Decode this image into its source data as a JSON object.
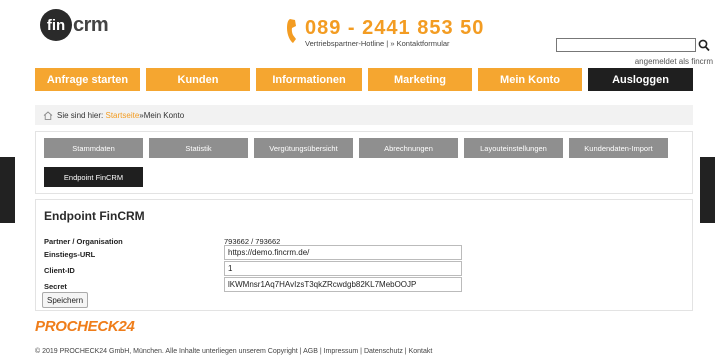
{
  "header": {
    "logo_circle": "fin",
    "logo_text": "crm",
    "phone": "089 - 2441 853 50",
    "hotline": "Vertriebspartner-Hotline",
    "hotline_sep": " | » ",
    "contact_link": "Kontaktformular",
    "search_placeholder": "",
    "logged_in": "angemeldet als fincrm"
  },
  "nav": {
    "items": [
      {
        "label": "Anfrage starten"
      },
      {
        "label": "Kunden"
      },
      {
        "label": "Informationen"
      },
      {
        "label": "Marketing"
      },
      {
        "label": "Mein Konto"
      },
      {
        "label": "Ausloggen"
      }
    ]
  },
  "breadcrumb": {
    "prefix": "Sie sind hier:",
    "home": "Startseite",
    "separator": " » ",
    "current": "Mein Konto"
  },
  "tabs": [
    {
      "label": "Stammdaten"
    },
    {
      "label": "Statistik"
    },
    {
      "label": "Vergütungsübersicht"
    },
    {
      "label": "Abrechnungen"
    },
    {
      "label": "Layouteinstellungen"
    },
    {
      "label": "Kundendaten-Import"
    },
    {
      "label": "Endpoint FinCRM"
    }
  ],
  "content": {
    "title": "Endpoint FinCRM",
    "partner_label": "Partner / Organisation",
    "partner_value": "793662 / 793662",
    "url_label": "Einstiegs-URL",
    "url_value": "https://demo.fincrm.de/",
    "client_label": "Client-ID",
    "client_value": "1",
    "secret_label": "Secret",
    "secret_value": "lKWMnsr1Aq7HAvIzsT3qkZRcwdgb82KL7MebOOJP",
    "save_label": "Speichern"
  },
  "brand": {
    "procheck": "PROCHECK24"
  },
  "footer": {
    "copyright": "© 2019 PROCHECK24 GmbH, München. Alle Inhalte unterliegen unserem Copyright",
    "sep": " | ",
    "agb": "AGB",
    "impressum": "Impressum",
    "datenschutz": "Datenschutz",
    "kontakt": "Kontakt"
  },
  "colors": {
    "accent": "#f5a630",
    "dark": "#1f1f1f",
    "tab_gray": "#8f8f8f",
    "brand_orange": "#ef7d1a"
  },
  "icons": {
    "phone": "phone-icon",
    "search": "search-icon",
    "home": "home-icon"
  }
}
